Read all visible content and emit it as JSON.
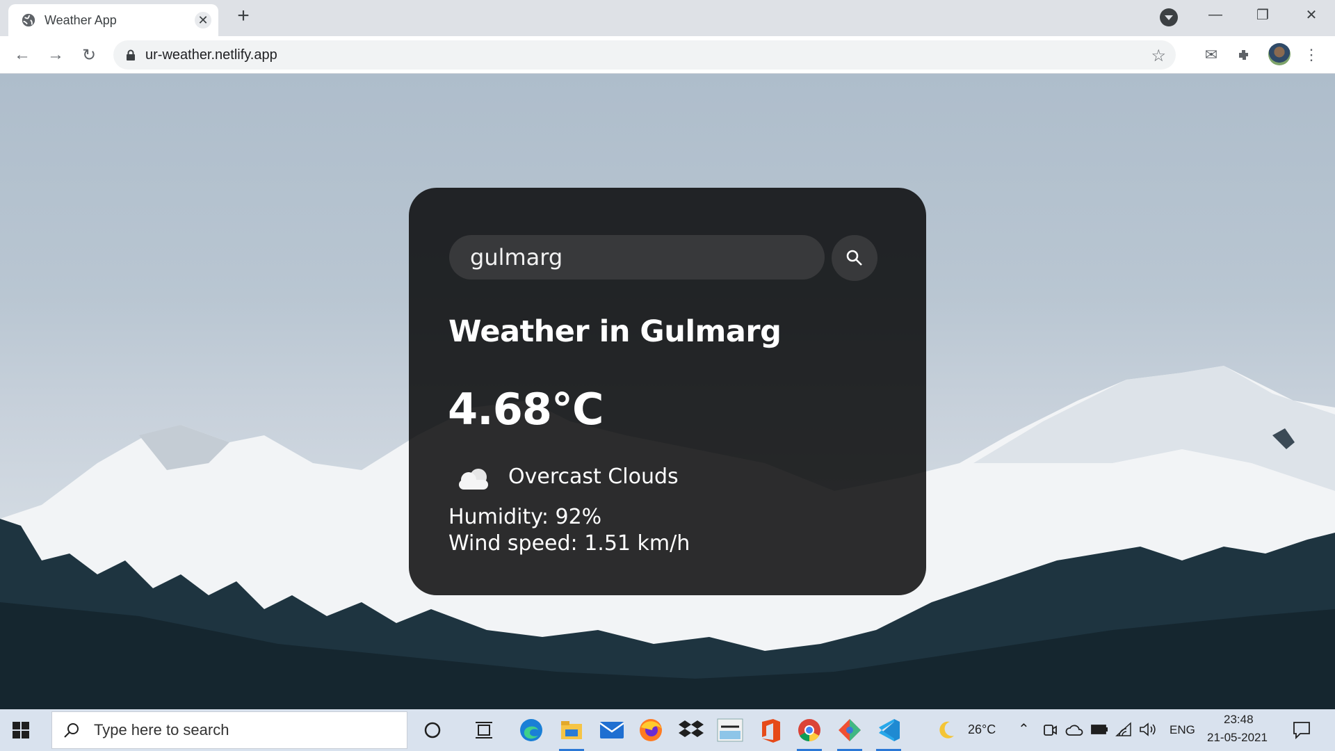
{
  "browser": {
    "tab_title": "Weather App",
    "url": "ur-weather.netlify.app",
    "icons": [
      "globe-icon",
      "close-icon",
      "plus-icon",
      "back-icon",
      "forward-icon",
      "reload-icon",
      "lock-icon",
      "star-icon",
      "mail-icon",
      "extensions-icon",
      "more-icon"
    ]
  },
  "weather": {
    "search_value": "gulmarg",
    "city_heading": "Weather in Gulmarg",
    "temperature": "4.68°C",
    "condition": "Overcast Clouds",
    "humidity": "Humidity: 92%",
    "wind": "Wind speed: 1.51 km/h"
  },
  "taskbar": {
    "search_placeholder": "Type here to search",
    "weather_temp": "26°C",
    "language": "ENG",
    "time": "23:48",
    "date": "21-05-2021",
    "accent_color": "#2b78d6"
  }
}
